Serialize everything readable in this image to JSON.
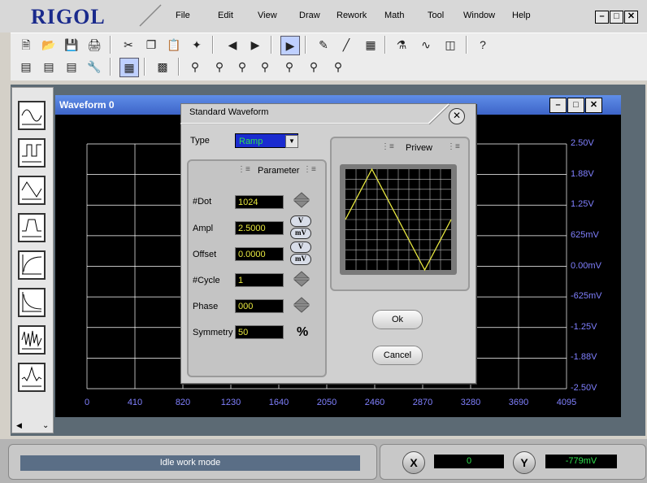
{
  "app": {
    "logo": "RIGOL",
    "menu": [
      "File",
      "Edit",
      "View",
      "Draw",
      "Rework",
      "Math",
      "Tool",
      "Window",
      "Help"
    ]
  },
  "waveform_window": {
    "title": "Waveform 0",
    "y_ticks": [
      "2.50V",
      "1.88V",
      "1.25V",
      "625mV",
      "0.00mV",
      "-625mV",
      "-1.25V",
      "-1.88V",
      "-2.50V"
    ],
    "x_ticks": [
      "0",
      "410",
      "820",
      "1230",
      "1640",
      "2050",
      "2460",
      "2870",
      "3280",
      "3690",
      "4095"
    ]
  },
  "dialog": {
    "title": "Standard Waveform",
    "type_label": "Type",
    "type_value": "Ramp",
    "parameter_title": "Parameter",
    "preview_title": "Privew",
    "params": [
      {
        "label": "#Dot",
        "value": "1024",
        "control": "spin"
      },
      {
        "label": "Ampl",
        "value": "2.5000",
        "control": "units",
        "units": [
          "V",
          "mV"
        ]
      },
      {
        "label": "Offset",
        "value": "0.0000",
        "control": "units",
        "units": [
          "V",
          "mV"
        ]
      },
      {
        "label": "#Cycle",
        "value": "1",
        "control": "spin"
      },
      {
        "label": "Phase",
        "value": "000",
        "control": "spin"
      },
      {
        "label": "Symmetry",
        "value": "50",
        "control": "percent"
      }
    ],
    "percent_symbol": "%",
    "ok_label": "Ok",
    "cancel_label": "Cancel"
  },
  "status": {
    "mode_text": "Idle work mode",
    "x_label": "X",
    "x_value": "0",
    "y_label": "Y",
    "y_value": "-779mV"
  },
  "colors": {
    "logo": "#1a2a8c",
    "scope_background": "#000000",
    "grid": "#ffffff",
    "axis_text": "#8080ff",
    "field_text": "#e8e840",
    "type_select_bg": "#1a2bd0",
    "type_select_text": "#2fe04d",
    "status_bg": "#5a6e86",
    "preview_trace": "#e8e840"
  },
  "icons": {
    "toolbar_row1": [
      "new-file-icon",
      "open-folder-icon",
      "save-icon",
      "print-icon",
      "cut-icon",
      "copy-icon",
      "paste-icon",
      "wand-icon",
      "prev-icon",
      "next-icon",
      "pointer-icon",
      "eraser-icon",
      "line-tool-icon",
      "grid-tool-icon",
      "connect-icon",
      "waveform-icon",
      "device-icon",
      "help-icon"
    ],
    "toolbar_row2": [
      "chart-edit-1-icon",
      "chart-edit-2-icon",
      "chart-edit-3-icon",
      "wrench-icon",
      "grid-view-icon",
      "dot-grid-icon",
      "zoom-fit-icon",
      "zoom-in-icon",
      "zoom-vertical-icon",
      "zoom-horizontal-icon",
      "zoom-out-icon",
      "zoom-reset-icon",
      "zoom-icon"
    ],
    "left_panel": [
      "sine-wave-icon",
      "square-wave-icon",
      "triangle-wave-icon",
      "pulse-wave-icon",
      "exp-rise-icon",
      "exp-fall-icon",
      "noise-icon",
      "sinc-icon"
    ]
  }
}
